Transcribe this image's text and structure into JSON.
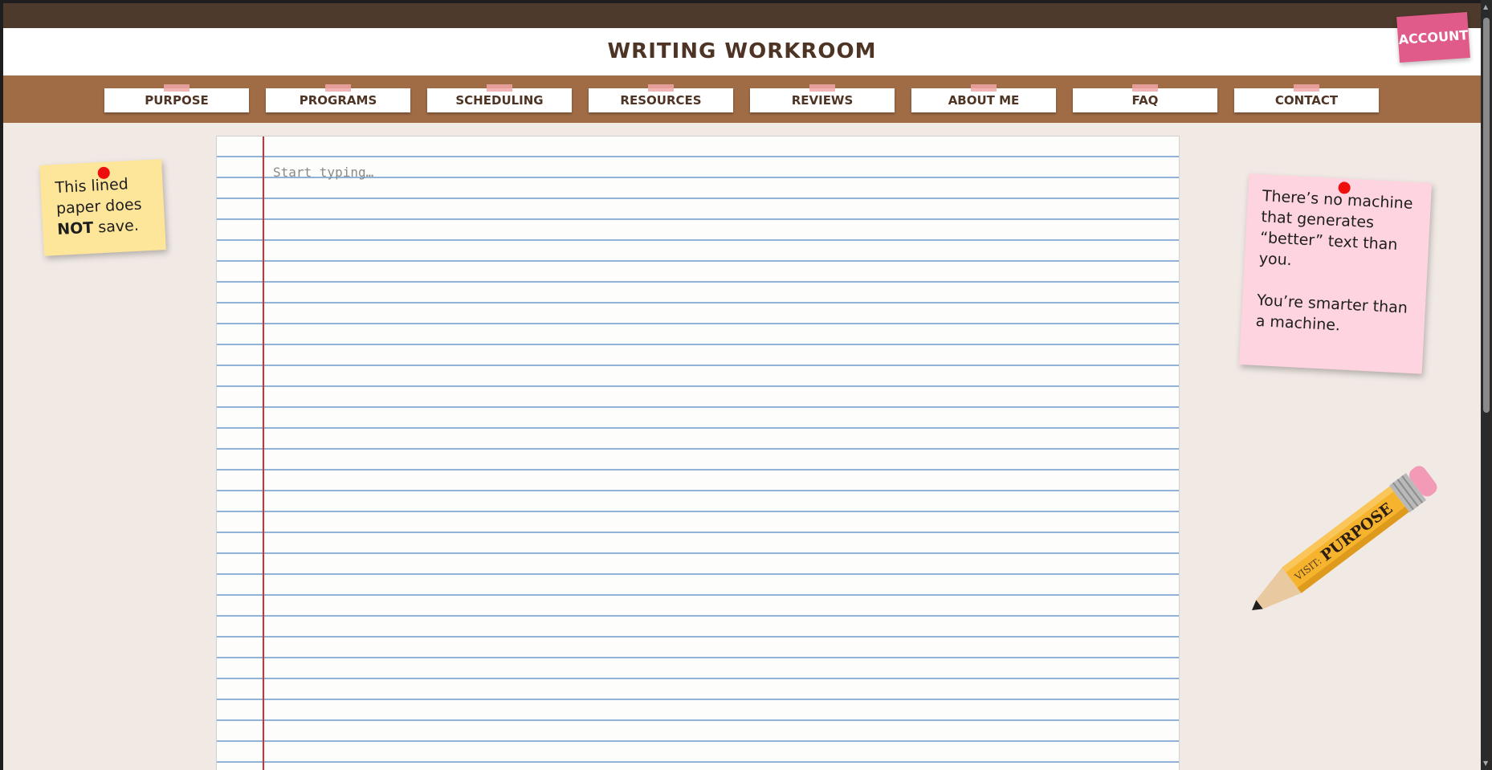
{
  "site": {
    "title": "WRITING WORKROOM",
    "account_label": "ACCOUNT"
  },
  "nav": {
    "items": [
      {
        "label": "PURPOSE"
      },
      {
        "label": "PROGRAMS"
      },
      {
        "label": "SCHEDULING"
      },
      {
        "label": "RESOURCES"
      },
      {
        "label": "REVIEWS"
      },
      {
        "label": "ABOUT ME"
      },
      {
        "label": "FAQ"
      },
      {
        "label": "CONTACT"
      }
    ]
  },
  "paper": {
    "placeholder": "Start typing…",
    "value": ""
  },
  "note_left": {
    "line1": "This lined",
    "line2": "paper does",
    "bold": "NOT",
    "line3_rest": " save."
  },
  "note_right": {
    "para1_l1": "There’s no machine",
    "para1_l2": "that generates",
    "para1_l3": "“better” text than",
    "para1_l4": "you.",
    "para2_l1": "You’re smarter than",
    "para2_l2": "a machine."
  },
  "pencil": {
    "visit_label": "VISIT:",
    "link_label": "PURPOSE"
  },
  "colors": {
    "top_strip": "#4e3a2c",
    "navbar": "#a06c46",
    "account": "#e05a8a",
    "note_yellow": "#fde59a",
    "note_pink": "#fdd4e0",
    "margin_line": "#cf3036",
    "rule_line": "#8fb2d6",
    "pin": "#ee0e0e"
  }
}
